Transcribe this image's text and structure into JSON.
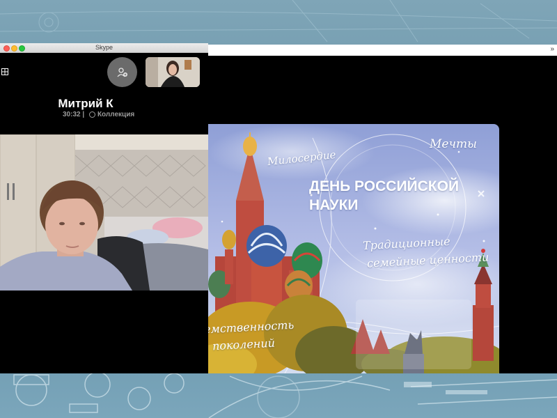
{
  "window": {
    "title": "Skype"
  },
  "call": {
    "caller_name": "Митрий К",
    "duration": "30:32",
    "separator": "|",
    "collection_label": "Коллекция"
  },
  "share": {
    "toolbar_arrows": "»"
  },
  "slide": {
    "title_line1": "ДЕНЬ РОССИЙСКОЙ",
    "title_line2": "НАУКИ",
    "word_miloserdie": "Милосердие",
    "word_mechty": "Мечты",
    "word_traditions_line1": "Традиционные",
    "word_traditions_line2": "семейные ценности",
    "word_preemstvennost_line1": "емственность",
    "word_preemstvennost_line2": "поколений"
  },
  "icons": {
    "grid": "grid-icon",
    "participants": "add-participant-icon",
    "collection": "collection-icon",
    "close": "close-icon",
    "minimize": "minimize-icon",
    "maximize": "maximize-icon"
  },
  "colors": {
    "background_blue": "#6f99ab",
    "skype_bg": "#000000",
    "slide_sky": "#aeb9e4",
    "close": "#fc5f57",
    "minimize": "#fdbc2e",
    "maximize": "#28c840"
  }
}
